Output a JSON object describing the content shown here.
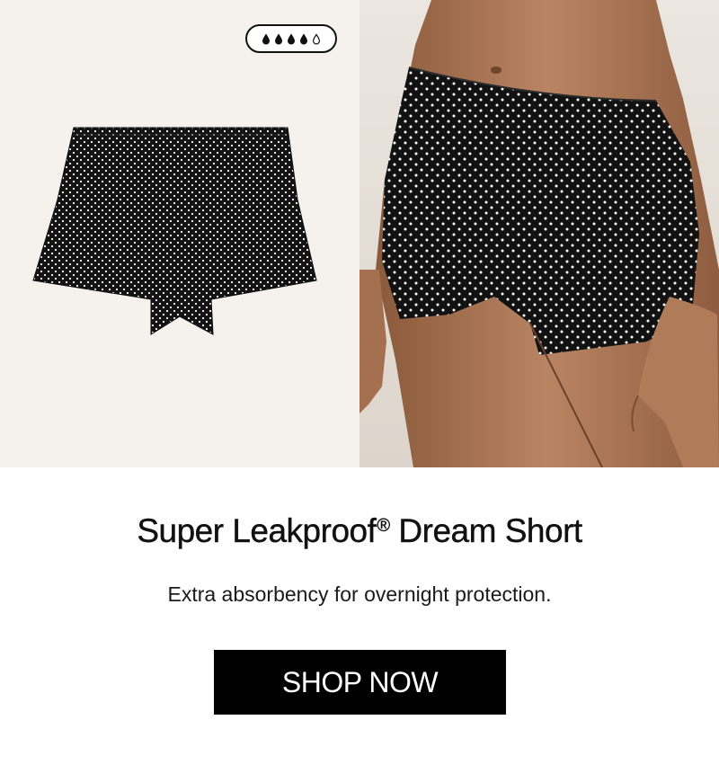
{
  "absorbency": {
    "level": 4,
    "max": 5,
    "icon": "water-drop-icon"
  },
  "images": {
    "flat_product": "flat-lay-polka-dot-boyshort-image",
    "model_product": "model-wearing-polka-dot-boyshort-image"
  },
  "product": {
    "title": "Super Leakproof",
    "title_mark": "®",
    "title_suffix": " Dream Short",
    "description": "Extra absorbency for overnight protection."
  },
  "cta": {
    "label": "SHOP NOW"
  },
  "colors": {
    "fabric": "#131313",
    "dot": "#ffffff",
    "left_background": "#f5f2ee",
    "button": "#000000",
    "button_text": "#ffffff"
  }
}
